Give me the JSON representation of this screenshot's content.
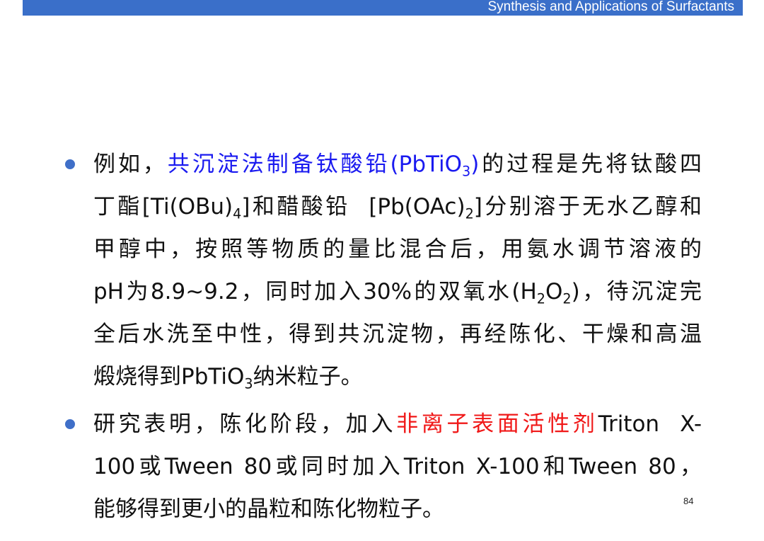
{
  "header": {
    "title": "Synthesis and Applications of Surfactants"
  },
  "bullets": [
    {
      "segments": {
        "s1": "例如，",
        "s2": "共沉淀法制备钛酸铅(PbTiO",
        "s3": "3",
        "s4": ")",
        "s5": "的过程是先将钛酸四",
        "s6": "丁酯[Ti(OBu)",
        "s7": "4",
        "s8": "]和醋酸铅  [Pb(OAc)",
        "s9": "2",
        "s10": "]分别溶于无水乙醇和",
        "s11": "甲醇中，按照等物质的量比混合后，用氨水调节溶液的",
        "s12": "pH为8.9~9.2，同时加入30%的双氧水(H",
        "s13": "2",
        "s14": "O",
        "s15": "2",
        "s16": ")，待沉淀完",
        "s17": "全后水洗至中性，得到共沉淀物，再经陈化、干燥和高温",
        "s18": "煅烧得到PbTiO",
        "s19": "3",
        "s20": "纳米粒子。"
      }
    },
    {
      "segments": {
        "s1": "研究表明，陈化阶段，加入",
        "s2": "非离子表面活性剂",
        "s3": "Triton  X-",
        "s4": "100或Tween 80或同时加入Triton X-100和Tween 80，",
        "s5": "能够得到更小的晶粒和陈化物粒子。"
      }
    }
  ],
  "page_number": "84",
  "colors": {
    "header": "#3a6fc9",
    "bullet": "#3f6fc8",
    "highlight_blue": "#1a1af0",
    "highlight_red": "#f01818"
  }
}
